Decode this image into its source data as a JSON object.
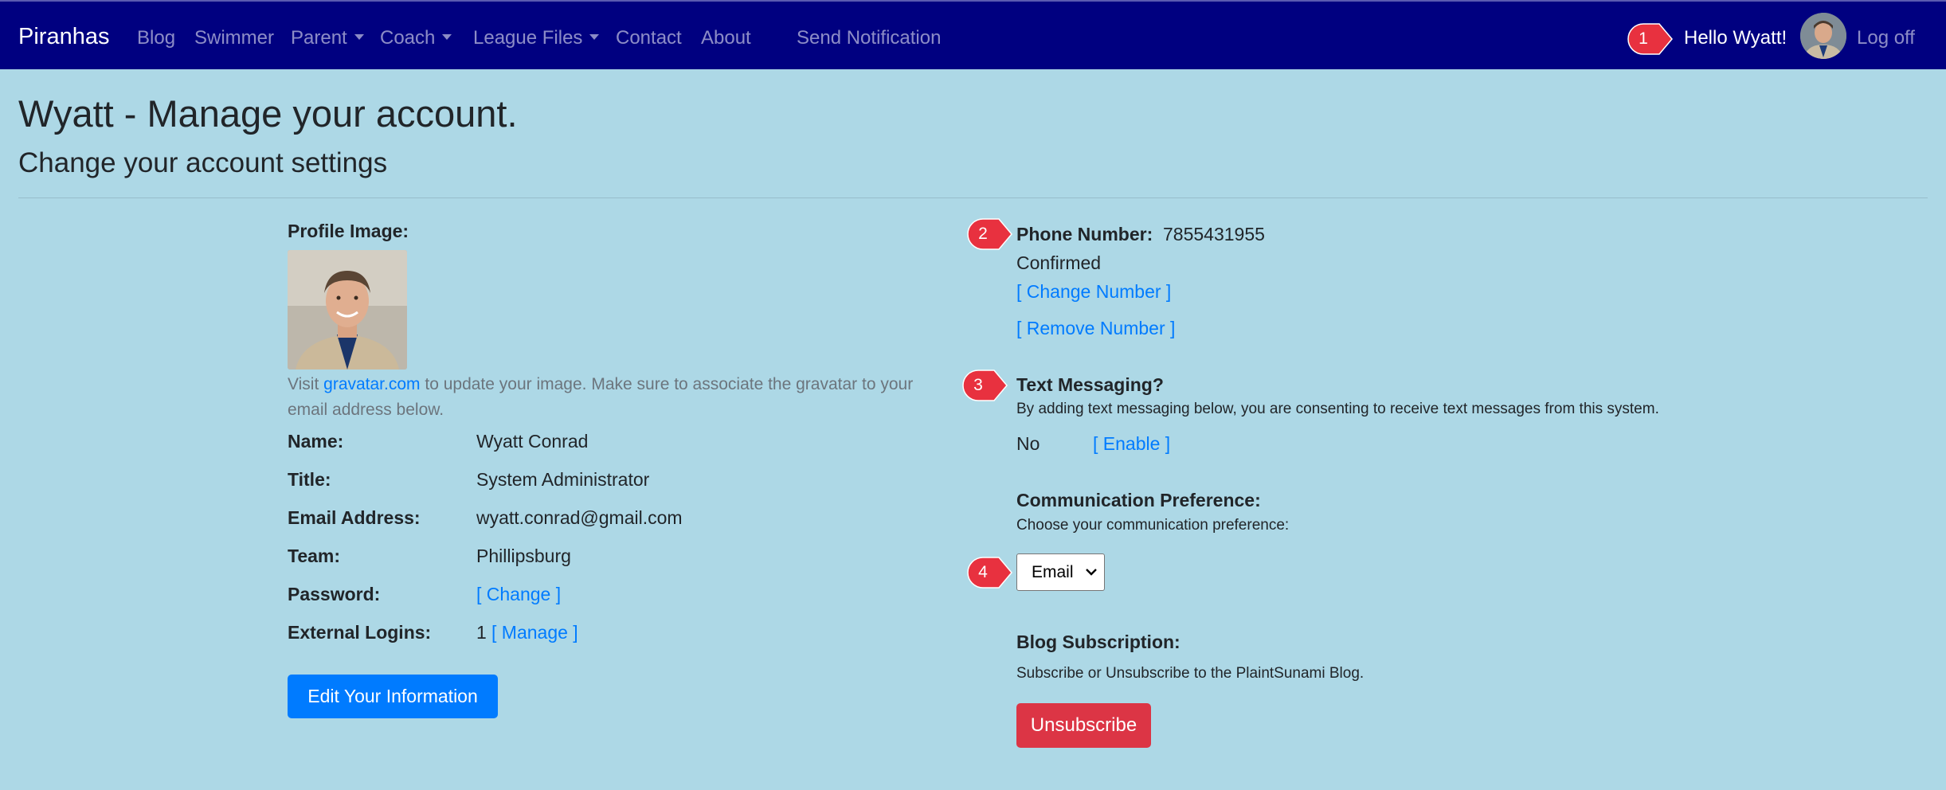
{
  "nav": {
    "brand": "Piranhas",
    "links": [
      "Blog",
      "Swimmer",
      "Parent",
      "Coach",
      "League Files",
      "Contact",
      "About",
      "Send Notification"
    ],
    "greeting": "Hello Wyatt!",
    "logoff": "Log off",
    "colors": {
      "background": "#000080",
      "link": "rgba(255,255,255,0.55)"
    }
  },
  "markers": [
    "1",
    "2",
    "3",
    "4"
  ],
  "page": {
    "title": "Wyatt - Manage your account.",
    "subtitle": "Change your account settings"
  },
  "profile": {
    "image_label": "Profile Image:",
    "note_prefix": "Visit ",
    "note_link": "gravatar.com",
    "note_suffix": " to update your image. Make sure to associate the gravatar to your email address below.",
    "fields": {
      "name_label": "Name:",
      "name_value": "Wyatt Conrad",
      "title_label": "Title:",
      "title_value": "System Administrator",
      "email_label": "Email Address:",
      "email_value": "wyatt.conrad@gmail.com",
      "team_label": "Team:",
      "team_value": "Phillipsburg",
      "password_label": "Password:",
      "password_link": "[  Change  ]",
      "logins_label": "External Logins:",
      "logins_count": "1",
      "logins_link": "[  Manage  ]"
    },
    "edit_button": "Edit Your Information"
  },
  "phone": {
    "label": "Phone Number:",
    "value": "7855431955",
    "status": "Confirmed",
    "change_link": "[  Change Number  ]",
    "remove_link": "[  Remove Number  ]"
  },
  "text_messaging": {
    "label": "Text Messaging?",
    "description": "By adding text messaging below, you are consenting to receive text messages from this system.",
    "value": "No",
    "enable_link": "[  Enable  ]"
  },
  "communication": {
    "label": "Communication Preference:",
    "description": "Choose your communication preference:",
    "selected": "Email"
  },
  "blog": {
    "label": "Blog Subscription:",
    "description": "Subscribe or Unsubscribe to the PlaintSunami Blog.",
    "button": "Unsubscribe"
  },
  "colors": {
    "page_background": "#add8e6",
    "link": "#007bff",
    "primary_button": "#007bff",
    "danger_button": "#dc3545",
    "marker": "#e8313f"
  }
}
